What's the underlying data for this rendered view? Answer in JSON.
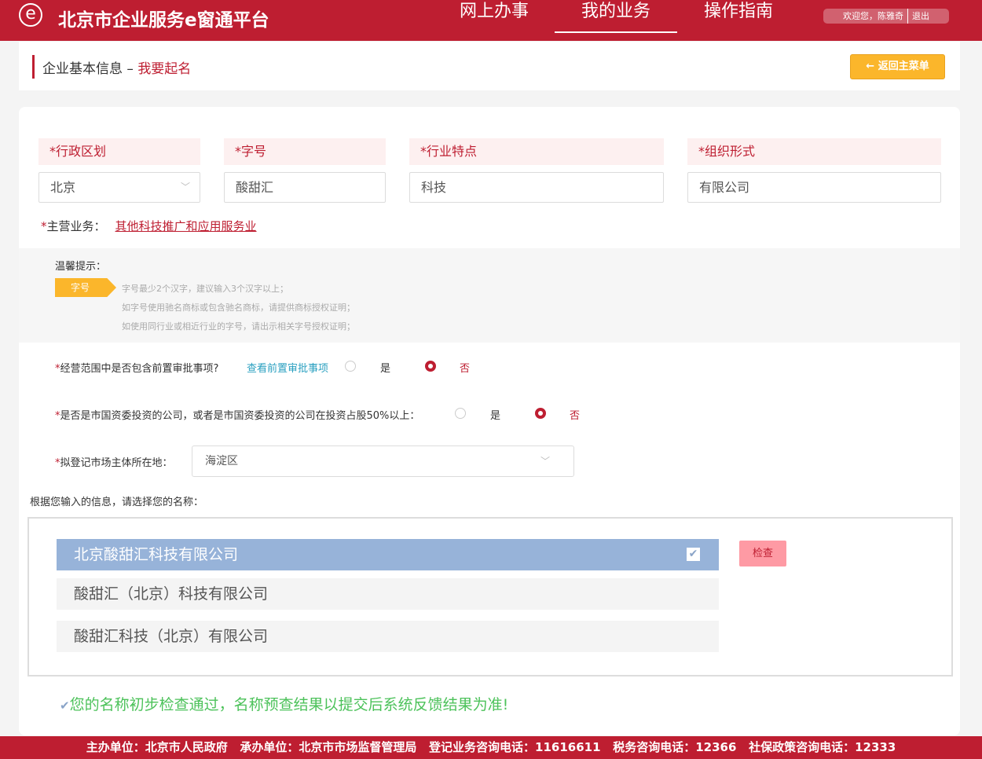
{
  "header": {
    "logo": "e",
    "title": "北京市企业服务e窗通平台",
    "nav": [
      "网上办事",
      "我的业务",
      "操作指南"
    ],
    "active_nav": 1,
    "welcome": "欢迎您，陈雅奇",
    "logout": "退出"
  },
  "titlebar": {
    "title": "企业基本信息",
    "sep": "–",
    "subtitle": "我要起名",
    "back": "← 返回主菜单"
  },
  "fields": [
    {
      "label": "*行政区划",
      "value": "北京"
    },
    {
      "label": "*字号",
      "value": "酸甜汇"
    },
    {
      "label": "*行业特点",
      "value": "科技"
    },
    {
      "label": "*组织形式",
      "value": "有限公司"
    }
  ],
  "main_business": {
    "label": "主营业务：",
    "value": "其他科技推广和应用服务业"
  },
  "tips": {
    "title": "温馨提示：",
    "tag": "字号",
    "lines": [
      "字号最少2个汉字，建议输入3个汉字以上；",
      "如字号使用驰名商标或包含驰名商标，请提供商标授权证明；",
      "如使用同行业或相近行业的字号，请出示相关字号授权证明；"
    ]
  },
  "q1": {
    "label": "经营范围中是否包含前置审批事项?",
    "link": "查看前置审批事项",
    "yes": "是",
    "no": "否",
    "selected": "否"
  },
  "q2": {
    "label": "是否是市国资委投资的公司，或者是市国资委投资的公司在投资占股50%以上：",
    "yes": "是",
    "no": "否",
    "selected": "否"
  },
  "q3": {
    "label": "拟登记市场主体所在地：",
    "value": "海淀区"
  },
  "pick_label": "根据您输入的信息，请选择您的名称：",
  "names": [
    "北京酸甜汇科技有限公司",
    "酸甜汇（北京）科技有限公司",
    "酸甜汇科技（北京）有限公司"
  ],
  "selected_name": 0,
  "check_button": "检查",
  "result": "您的名称初步检查通过，名称预查结果以提交后系统反馈结果为准!",
  "footer": "主办单位：北京市人民政府   承办单位：北京市市场监督管理局   登记业务咨询电话：11616611   税务咨询电话：12366   社保政策咨询电话：12333",
  "colors": {
    "brand": "#be1e31",
    "accent": "#fbb62b",
    "success": "#4cc25a",
    "selected": "#97b3d9"
  }
}
